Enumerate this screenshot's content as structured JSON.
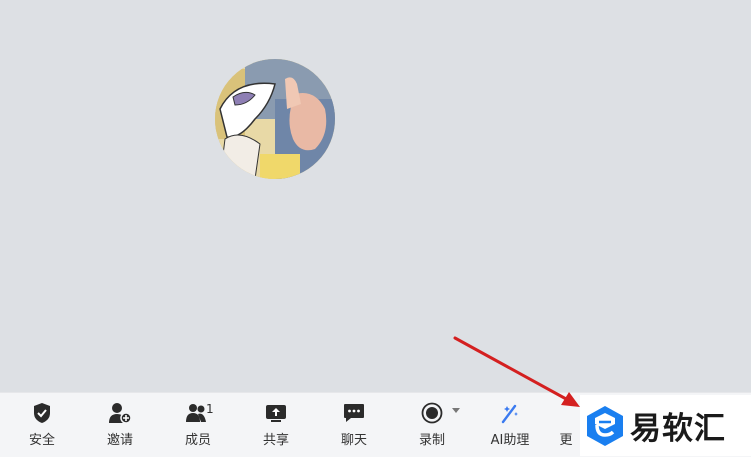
{
  "toolbar": {
    "items": [
      {
        "label": "安全",
        "icon": "shield-icon"
      },
      {
        "label": "邀请",
        "icon": "add-user-icon"
      },
      {
        "label": "成员",
        "icon": "members-icon",
        "count": "1"
      },
      {
        "label": "共享",
        "icon": "share-screen-icon"
      },
      {
        "label": "聊天",
        "icon": "chat-icon"
      },
      {
        "label": "录制",
        "icon": "record-icon"
      },
      {
        "label": "AI助理",
        "icon": "ai-assistant-icon"
      },
      {
        "label": "更",
        "icon": "more-icon"
      }
    ]
  },
  "watermark": {
    "text": "易软汇"
  },
  "colors": {
    "icon": "#2b2b2b",
    "ai_accent": "#3a7af0",
    "annotation_arrow": "#d42020",
    "logo_blue": "#1a7ff0"
  }
}
